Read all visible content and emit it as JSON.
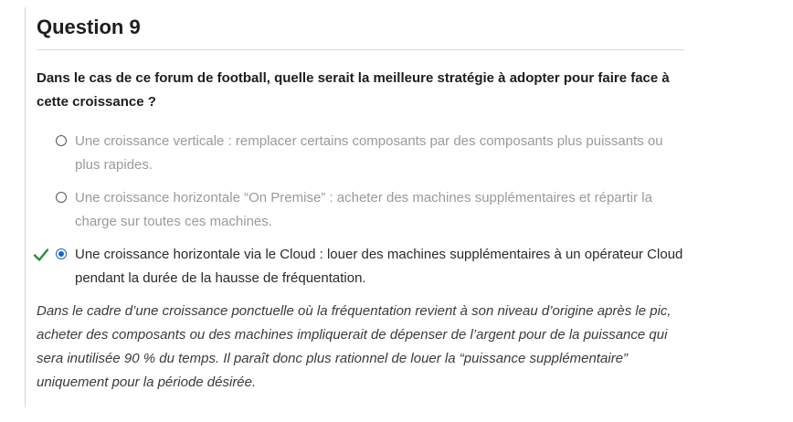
{
  "question": {
    "title": "Question 9",
    "prompt": "Dans le cas de ce forum de football, quelle serait la meilleure stratégie à adopter pour faire face à cette croissance ?",
    "options": [
      {
        "label": "Une croissance verticale : remplacer certains composants par des composants plus puissants ou plus rapides.",
        "selected": false,
        "correct": false
      },
      {
        "label": "Une croissance horizontale “On Premise” : acheter des machines supplémentaires et répartir la charge sur toutes ces machines.",
        "selected": false,
        "correct": false
      },
      {
        "label": "Une croissance horizontale via le Cloud : louer des machines supplémentaires à un opérateur Cloud pendant la durée de la hausse de fréquentation.",
        "selected": true,
        "correct": true
      }
    ],
    "explanation": "Dans le cadre d’une croissance ponctuelle où la fréquentation revient à son niveau d’origine après le pic, acheter des composants ou des machines impliquerait de dépenser de l’argent pour de la puissance qui sera inutilisée 90 % du temps. Il paraît donc plus rationnel de louer la “puissance supplémentaire” uniquement pour la période désirée."
  },
  "icons": {
    "correct": "checkmark-icon",
    "radio": "radio-button-icon"
  },
  "colors": {
    "correct_check": "#2e8b3a",
    "radio_selected": "#1e63c9"
  }
}
